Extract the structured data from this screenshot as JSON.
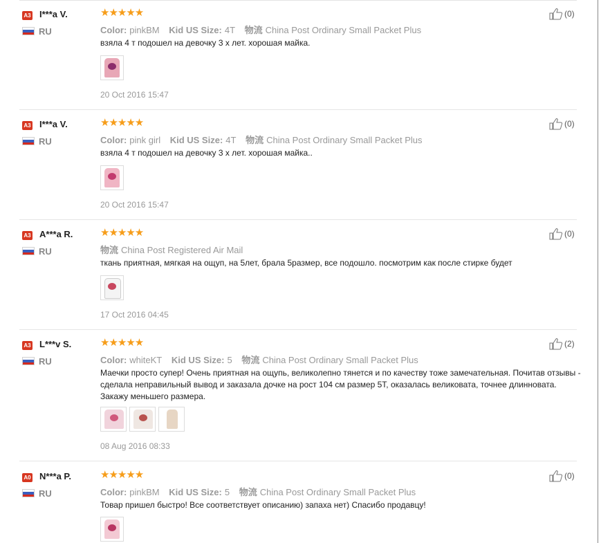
{
  "reviews": [
    {
      "level": "A3",
      "name": "I***a V.",
      "country": "RU",
      "attrs": [
        [
          "Color:",
          "pinkBM"
        ],
        [
          "Kid US Size:",
          "4T"
        ],
        [
          "物流",
          "China Post Ordinary Small Packet Plus"
        ]
      ],
      "text": "взяла 4 т подошел на девочку 3 х лет. хорошая майка.",
      "date": "20 Oct 2016 15:47",
      "helpful": "(0)",
      "stars": "★★★★★"
    },
    {
      "level": "A3",
      "name": "I***a V.",
      "country": "RU",
      "attrs": [
        [
          "Color:",
          "pink girl"
        ],
        [
          "Kid US Size:",
          "4T"
        ],
        [
          "物流",
          "China Post Ordinary Small Packet Plus"
        ]
      ],
      "text": "взяла 4 т подошел на девочку 3 х лет. хорошая майка..",
      "date": "20 Oct 2016 15:47",
      "helpful": "(0)",
      "stars": "★★★★★"
    },
    {
      "level": "A3",
      "name": "A***a R.",
      "country": "RU",
      "attrs": [
        [
          "物流",
          "China Post Registered Air Mail"
        ]
      ],
      "text": "ткань приятная, мягкая на ощуп, на 5лет, брала 5размер, все подошло. посмотрим как после стирке будет",
      "date": "17 Oct 2016 04:45",
      "helpful": "(0)",
      "stars": "★★★★★"
    },
    {
      "level": "A3",
      "name": "L***v S.",
      "country": "RU",
      "attrs": [
        [
          "Color:",
          "whiteKT"
        ],
        [
          "Kid US Size:",
          "5"
        ],
        [
          "物流",
          "China Post Ordinary Small Packet Plus"
        ]
      ],
      "text": "Маечки просто супер! Очень приятная на ощупь, великолепно тянется и по качеству тоже замечательная. Почитав отзывы - сделала неправильный вывод и заказала дочке на рост 104 см размер 5Т, оказалась великовата, точнее длинновата. Закажу меньшего размера.",
      "date": "08 Aug 2016 08:33",
      "helpful": "(2)",
      "stars": "★★★★★"
    },
    {
      "level": "A0",
      "name": "N***a P.",
      "country": "RU",
      "attrs": [
        [
          "Color:",
          "pinkBM"
        ],
        [
          "Kid US Size:",
          "5"
        ],
        [
          "物流",
          "China Post Ordinary Small Packet Plus"
        ]
      ],
      "text": "Товар пришел быстро! Все соответствует описанию) запаха нет) Спасибо продавцу!",
      "date": "",
      "helpful": "(0)",
      "stars": "★★★★★"
    }
  ],
  "icons": {
    "helpful": "thumbs-up-icon",
    "flag": "russia-flag-icon",
    "rating": "star-icon"
  },
  "colors": {
    "star": "#f69d1a",
    "badge": "#d73721"
  }
}
